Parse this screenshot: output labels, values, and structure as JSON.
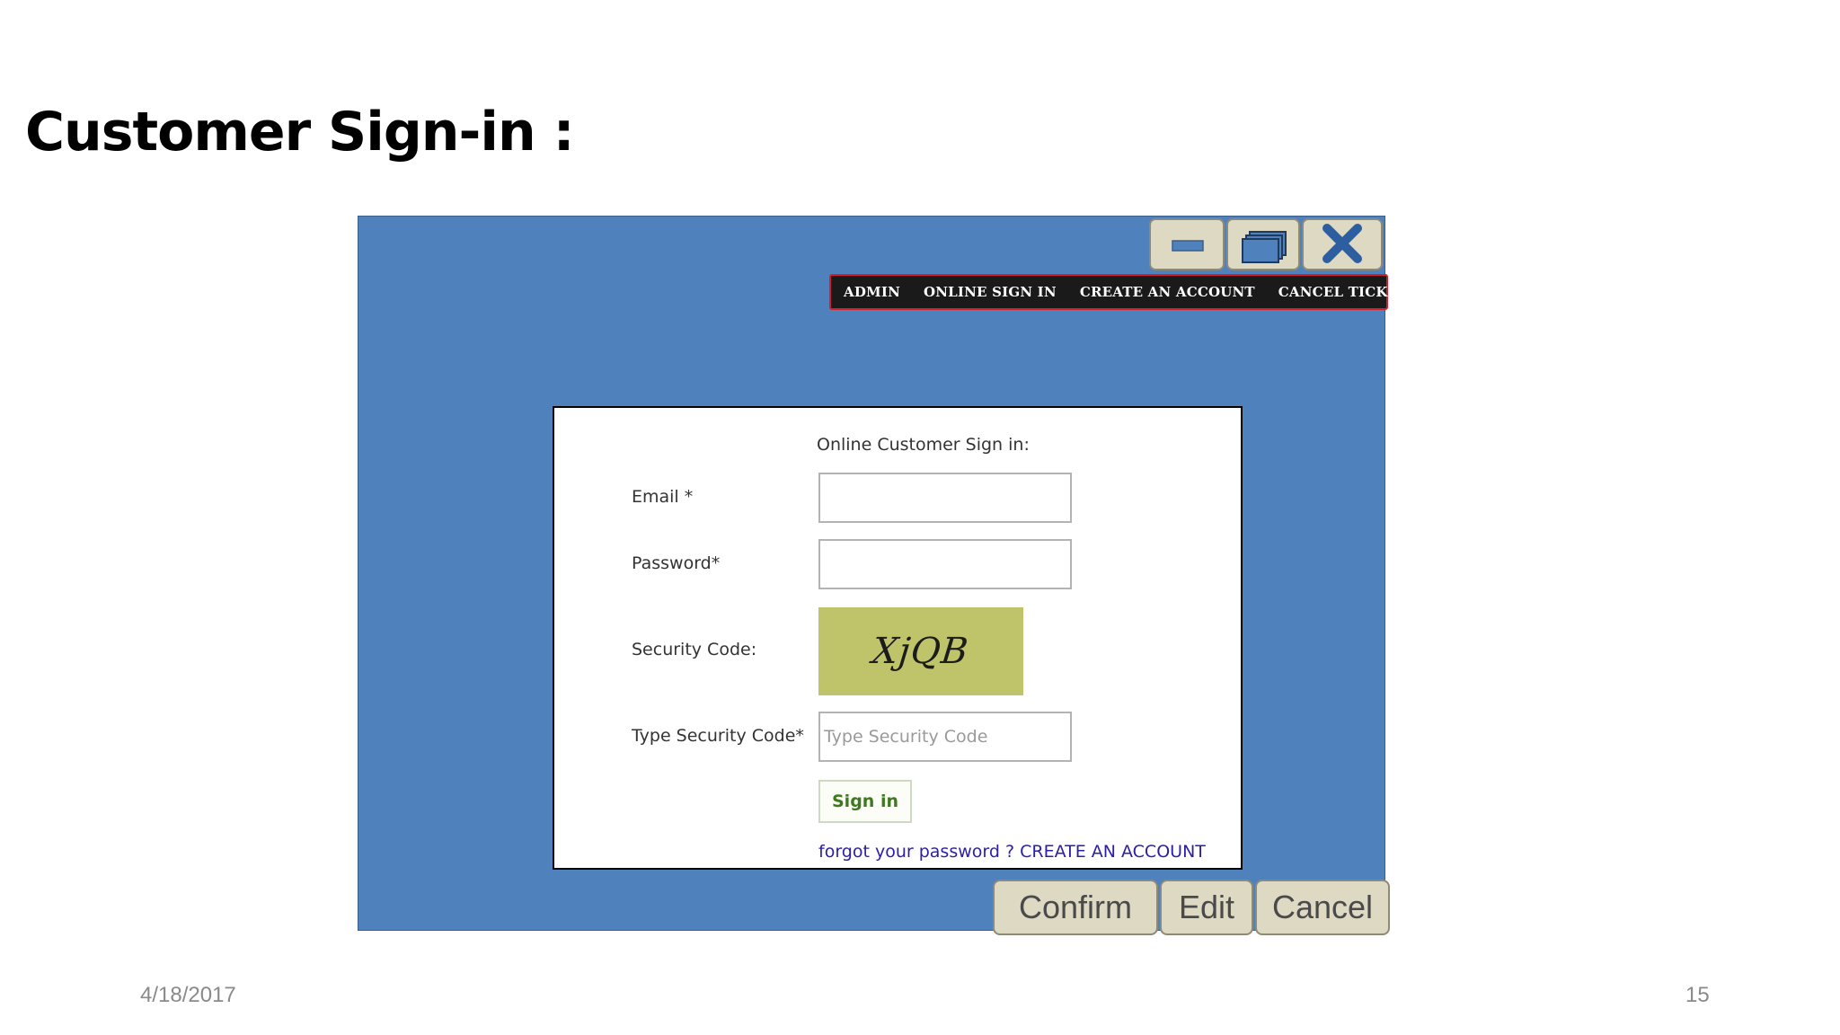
{
  "slide": {
    "title": "Customer Sign-in :",
    "date": "4/18/2017",
    "page_number": "15"
  },
  "window_controls": {
    "minimize_icon": "minimize-icon",
    "maximize_icon": "restore-windows-icon",
    "close_icon": "close-x-icon",
    "button_color": "#ddd9c3",
    "icon_color": "#4f81bd"
  },
  "nav": {
    "items": [
      {
        "label": "ADMIN"
      },
      {
        "label": "ONLINE SIGN IN"
      },
      {
        "label": "CREATE AN ACCOUNT"
      },
      {
        "label": "CANCEL TICKETS"
      }
    ]
  },
  "form": {
    "heading": "Online Customer Sign in:",
    "email_label": "Email *",
    "email_value": "",
    "password_label": "Password*",
    "password_value": "",
    "security_label": "Security Code:",
    "captcha_text": "XjQB",
    "type_code_label": "Type Security Code*",
    "type_code_placeholder": "Type Security Code",
    "type_code_value": "",
    "signin_label": "Sign in",
    "forgot_link": "forgot your password ?",
    "create_link": "CREATE AN ACCOUNT"
  },
  "actions": {
    "confirm_label": "Confirm",
    "edit_label": "Edit",
    "cancel_label": "Cancel"
  },
  "colors": {
    "window_background": "#4f81bd",
    "nav_background": "#1a1a1a",
    "nav_border": "#d2202a",
    "captcha_background": "#bfc36a",
    "signin_text": "#3d7a1e",
    "link_text": "#2a1fa5"
  }
}
